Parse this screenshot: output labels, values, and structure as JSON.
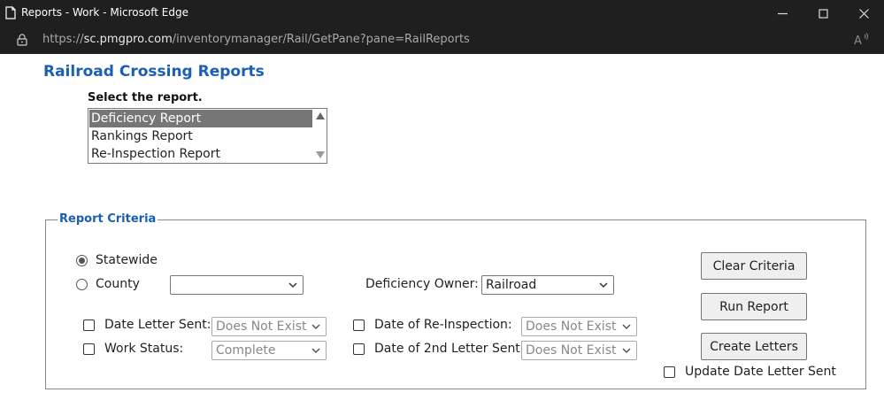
{
  "window": {
    "title": "Reports - Work - Microsoft Edge",
    "url_prefix": "https://",
    "url_host": "sc.pmgpro.com",
    "url_path": "/inventorymanager/Rail/GetPane?pane=RailReports"
  },
  "page": {
    "title": "Railroad Crossing Reports",
    "select_label": "Select the report."
  },
  "report_list": {
    "options": [
      "Deficiency Report",
      "Rankings Report",
      "Re-Inspection Report"
    ],
    "selected": "Deficiency Report"
  },
  "criteria": {
    "legend": "Report Criteria",
    "statewide_label": "Statewide",
    "county_label": "County",
    "county_value": "",
    "statewide_checked": true,
    "deficiency_owner_label": "Deficiency Owner:",
    "deficiency_owner_value": "Railroad",
    "date_letter_sent_label": "Date Letter Sent:",
    "date_letter_sent_value": "Does Not Exist",
    "work_status_label": "Work Status:",
    "work_status_value": "Complete",
    "date_reinspection_label": "Date of Re-Inspection:",
    "date_reinspection_value": "Does Not Exist",
    "date_2nd_letter_label": "Date of 2nd Letter Sent:",
    "date_2nd_letter_value": "Does Not Exist",
    "update_date_letter_label": "Update Date Letter Sent"
  },
  "buttons": {
    "clear": "Clear Criteria",
    "run": "Run Report",
    "create_letters": "Create Letters"
  },
  "colors": {
    "accent": "#1a5fb4",
    "titlebar": "#1f1f1f",
    "selected_option": "#767676"
  }
}
